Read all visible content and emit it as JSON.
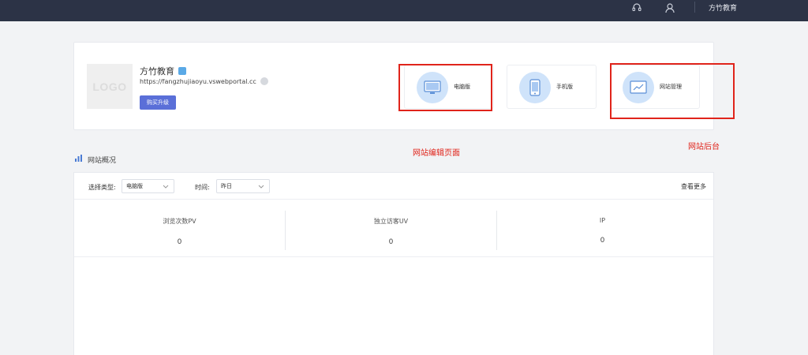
{
  "topbar": {
    "support_icon": "headset-icon",
    "user_icon": "user-icon",
    "account_name": "方竹教育"
  },
  "site": {
    "logo_text": "LOGO",
    "name": "方竹教育",
    "url": "https://fangzhujiaoyu.vswebportal.cc",
    "buy_button": "购买升级"
  },
  "modes": [
    {
      "label": "电脑版",
      "icon": "desktop-icon"
    },
    {
      "label": "手机版",
      "icon": "mobile-icon"
    },
    {
      "label": "网站管理",
      "icon": "site-admin-icon"
    }
  ],
  "annotations": {
    "edit_page": "网站编辑页面",
    "backend": "网站后台"
  },
  "overview": {
    "title": "网站概况",
    "filter_type_label": "选择类型:",
    "filter_type_value": "电脑版",
    "filter_time_label": "时间:",
    "filter_time_value": "昨日",
    "more_link": "查看更多",
    "metrics": [
      {
        "label": "浏览次数PV",
        "value": "0"
      },
      {
        "label": "独立访客UV",
        "value": "0"
      },
      {
        "label": "IP",
        "value": "0"
      }
    ]
  },
  "colors": {
    "topbar": "#2c3346",
    "primary_button": "#5a6fd8",
    "annotation_red": "#e0241b",
    "icon_circle": "#cfe3fa"
  }
}
